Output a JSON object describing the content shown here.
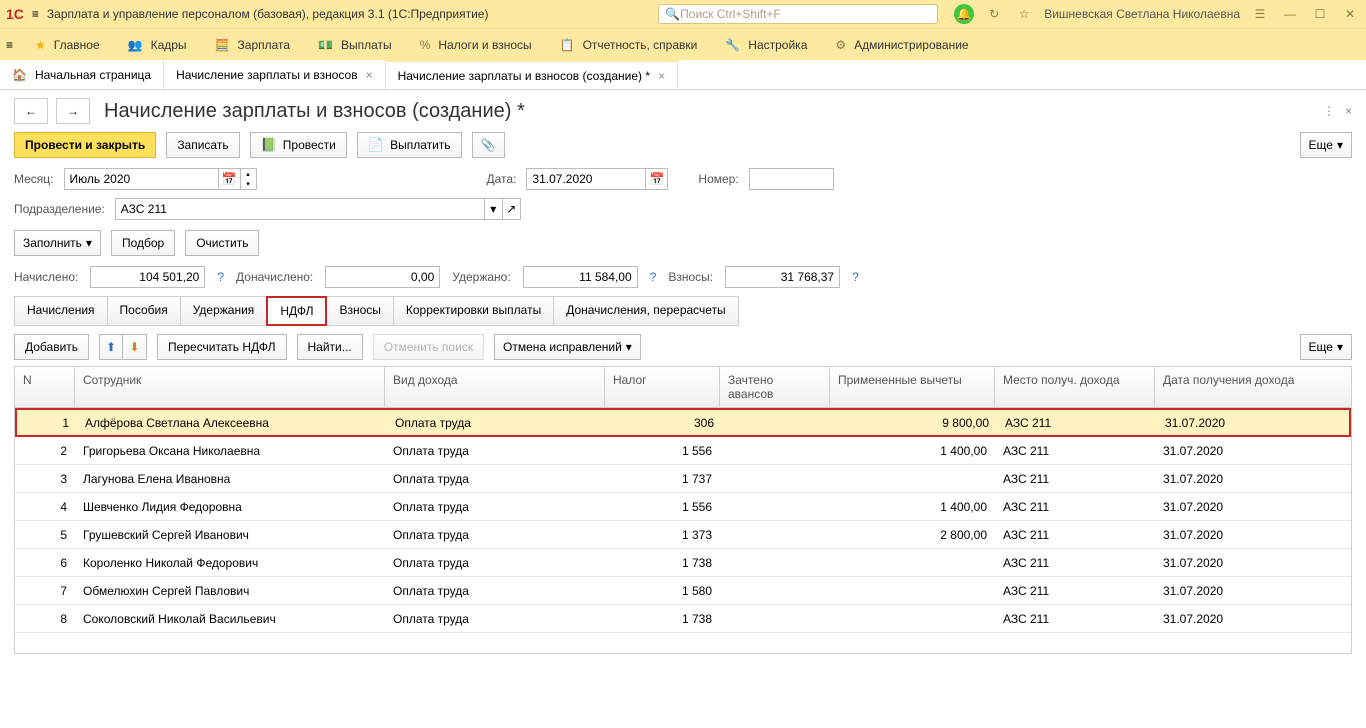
{
  "titlebar": {
    "app_title": "Зарплата и управление персоналом (базовая), редакция 3.1  (1С:Предприятие)",
    "search_placeholder": "Поиск Ctrl+Shift+F",
    "user": "Вишневская Светлана Николаевна"
  },
  "menu": [
    {
      "icon": "★",
      "label": "Главное"
    },
    {
      "icon": "👥",
      "label": "Кадры"
    },
    {
      "icon": "🧮",
      "label": "Зарплата"
    },
    {
      "icon": "💵",
      "label": "Выплаты"
    },
    {
      "icon": "%",
      "label": "Налоги и взносы"
    },
    {
      "icon": "📋",
      "label": "Отчетность, справки"
    },
    {
      "icon": "🔧",
      "label": "Настройка"
    },
    {
      "icon": "⚙",
      "label": "Администрирование"
    }
  ],
  "tabs": [
    {
      "icon": "🏠",
      "label": "Начальная страница",
      "closable": false
    },
    {
      "icon": "",
      "label": "Начисление зарплаты и взносов",
      "closable": true
    },
    {
      "icon": "",
      "label": "Начисление зарплаты и взносов (создание) *",
      "closable": true,
      "active": true
    }
  ],
  "page": {
    "title": "Начисление зарплаты и взносов (создание) *",
    "btn_post_close": "Провести и закрыть",
    "btn_save": "Записать",
    "btn_post": "Провести",
    "btn_pay": "Выплатить",
    "btn_more": "Еще",
    "lbl_month": "Месяц:",
    "val_month": "Июль 2020",
    "lbl_date": "Дата:",
    "val_date": "31.07.2020",
    "lbl_number": "Номер:",
    "lbl_subdiv": "Подразделение:",
    "val_subdiv": "АЗС 211",
    "btn_fill": "Заполнить",
    "btn_pick": "Подбор",
    "btn_clear": "Очистить",
    "sums": {
      "lbl_accrued": "Начислено:",
      "val_accrued": "104 501,20",
      "lbl_addl": "Доначислено:",
      "val_addl": "0,00",
      "lbl_withheld": "Удержано:",
      "val_withheld": "11 584,00",
      "lbl_contrib": "Взносы:",
      "val_contrib": "31 768,37"
    },
    "tabs2": [
      "Начисления",
      "Пособия",
      "Удержания",
      "НДФЛ",
      "Взносы",
      "Корректировки выплаты",
      "Доначисления, перерасчеты"
    ],
    "tabs2_active": "НДФЛ",
    "btn_add": "Добавить",
    "btn_recalc": "Пересчитать НДФЛ",
    "btn_find": "Найти...",
    "btn_cancel_search": "Отменить поиск",
    "btn_cancel_fix": "Отмена исправлений",
    "grid_headers": [
      "N",
      "Сотрудник",
      "Вид дохода",
      "Налог",
      "Зачтено авансов",
      "Примененные вычеты",
      "Место получ. дохода",
      "Дата получения дохода"
    ],
    "rows": [
      {
        "n": "1",
        "emp": "Алфёрова Светлана Алексеевна",
        "type": "Оплата труда",
        "tax": "306",
        "adv": "",
        "ded": "9 800,00",
        "place": "АЗС 211",
        "date": "31.07.2020",
        "sel": true
      },
      {
        "n": "2",
        "emp": "Григорьева Оксана Николаевна",
        "type": "Оплата труда",
        "tax": "1 556",
        "adv": "",
        "ded": "1 400,00",
        "place": "АЗС 211",
        "date": "31.07.2020"
      },
      {
        "n": "3",
        "emp": "Лагунова Елена Ивановна",
        "type": "Оплата труда",
        "tax": "1 737",
        "adv": "",
        "ded": "",
        "place": "АЗС 211",
        "date": "31.07.2020"
      },
      {
        "n": "4",
        "emp": "Шевченко Лидия Федоровна",
        "type": "Оплата труда",
        "tax": "1 556",
        "adv": "",
        "ded": "1 400,00",
        "place": "АЗС 211",
        "date": "31.07.2020"
      },
      {
        "n": "5",
        "emp": "Грушевский Сергей Иванович",
        "type": "Оплата труда",
        "tax": "1 373",
        "adv": "",
        "ded": "2 800,00",
        "place": "АЗС 211",
        "date": "31.07.2020"
      },
      {
        "n": "6",
        "emp": "Короленко Николай Федорович",
        "type": "Оплата труда",
        "tax": "1 738",
        "adv": "",
        "ded": "",
        "place": "АЗС 211",
        "date": "31.07.2020"
      },
      {
        "n": "7",
        "emp": "Обмелюхин Сергей Павлович",
        "type": "Оплата труда",
        "tax": "1 580",
        "adv": "",
        "ded": "",
        "place": "АЗС 211",
        "date": "31.07.2020"
      },
      {
        "n": "8",
        "emp": "Соколовский Николай Васильевич",
        "type": "Оплата труда",
        "tax": "1 738",
        "adv": "",
        "ded": "",
        "place": "АЗС 211",
        "date": "31.07.2020"
      }
    ]
  }
}
